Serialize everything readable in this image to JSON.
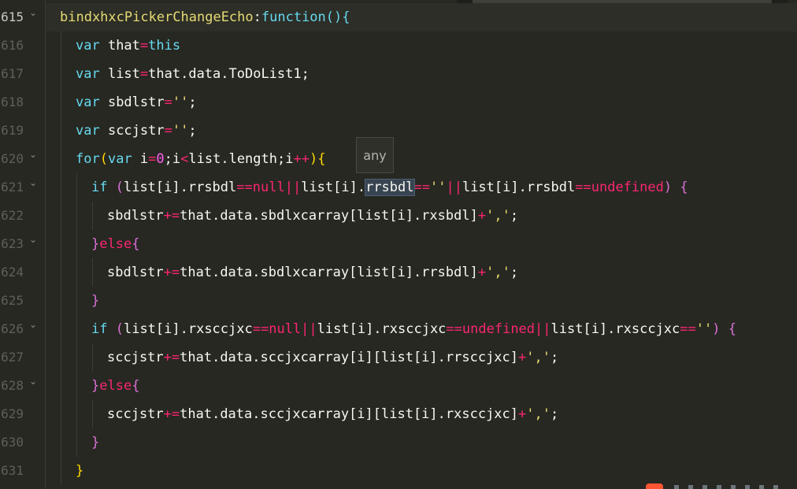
{
  "editor": {
    "line_numbers": [
      "615",
      "616",
      "617",
      "618",
      "619",
      "620",
      "621",
      "622",
      "623",
      "624",
      "625",
      "626",
      "627",
      "628",
      "629",
      "630",
      "631"
    ],
    "tooltip": "any",
    "lines": [
      [
        [
          "fn",
          "bindxhxcPickerChangeEcho"
        ],
        [
          "pl",
          ":"
        ],
        [
          "kw",
          "function"
        ],
        [
          "b1",
          "()"
        ],
        [
          "b1",
          "{"
        ]
      ],
      [
        [
          "kw",
          "var "
        ],
        [
          "pl",
          "that"
        ],
        [
          "op",
          "="
        ],
        [
          "kw",
          "this"
        ]
      ],
      [
        [
          "kw",
          "var "
        ],
        [
          "pl",
          "list"
        ],
        [
          "op",
          "="
        ],
        [
          "pl",
          "that.data.ToDoList1;"
        ]
      ],
      [
        [
          "kw",
          "var "
        ],
        [
          "pl",
          "sbdlstr"
        ],
        [
          "op",
          "="
        ],
        [
          "str",
          "''"
        ],
        [
          "pl",
          ";"
        ]
      ],
      [
        [
          "kw",
          "var "
        ],
        [
          "pl",
          "sccjstr"
        ],
        [
          "op",
          "="
        ],
        [
          "str",
          "''"
        ],
        [
          "pl",
          ";"
        ]
      ],
      [
        [
          "kw",
          "for"
        ],
        [
          "b2",
          "("
        ],
        [
          "kw",
          "var "
        ],
        [
          "pl",
          "i"
        ],
        [
          "op",
          "="
        ],
        [
          "num",
          "0"
        ],
        [
          "pl",
          ";i"
        ],
        [
          "op",
          "<"
        ],
        [
          "pl",
          "list.length;i"
        ],
        [
          "op",
          "++"
        ],
        [
          "b2",
          ")"
        ],
        [
          "b2",
          "{"
        ]
      ],
      [
        [
          "kw",
          "if "
        ],
        [
          "b3",
          "("
        ],
        [
          "pl",
          "list[i].rrsbdl"
        ],
        [
          "op",
          "=="
        ],
        [
          "nul",
          "null"
        ],
        [
          "op",
          "||"
        ],
        [
          "pl",
          "list[i]."
        ],
        [
          "hl",
          "rrsbdl"
        ],
        [
          "op",
          "=="
        ],
        [
          "str",
          "''"
        ],
        [
          "op",
          "||"
        ],
        [
          "pl",
          "list[i].rrsbdl"
        ],
        [
          "op",
          "=="
        ],
        [
          "nul",
          "undefined"
        ],
        [
          "b3",
          ")"
        ],
        [
          "pl",
          " "
        ],
        [
          "b3",
          "{"
        ]
      ],
      [
        [
          "pl",
          "sbdlstr"
        ],
        [
          "op",
          "+="
        ],
        [
          "pl",
          "that.data.sbdlxcarray[list[i].rxsbdl]"
        ],
        [
          "op",
          "+"
        ],
        [
          "str",
          "','"
        ],
        [
          "pl",
          ";"
        ]
      ],
      [
        [
          "b3",
          "}"
        ],
        [
          "kw2",
          "else"
        ],
        [
          "b3",
          "{"
        ]
      ],
      [
        [
          "pl",
          "sbdlstr"
        ],
        [
          "op",
          "+="
        ],
        [
          "pl",
          "that.data.sbdlxcarray[list[i].rrsbdl]"
        ],
        [
          "op",
          "+"
        ],
        [
          "str",
          "','"
        ],
        [
          "pl",
          ";"
        ]
      ],
      [
        [
          "b3",
          "}"
        ]
      ],
      [
        [
          "kw",
          "if "
        ],
        [
          "b3",
          "("
        ],
        [
          "pl",
          "list[i].rxsccjxc"
        ],
        [
          "op",
          "=="
        ],
        [
          "nul",
          "null"
        ],
        [
          "op",
          "||"
        ],
        [
          "pl",
          "list[i].rxsccjxc"
        ],
        [
          "op",
          "=="
        ],
        [
          "nul",
          "undefined"
        ],
        [
          "op",
          "||"
        ],
        [
          "pl",
          "list[i].rxsccjxc"
        ],
        [
          "op",
          "=="
        ],
        [
          "str",
          "''"
        ],
        [
          "b3",
          ")"
        ],
        [
          "pl",
          " "
        ],
        [
          "b3",
          "{"
        ]
      ],
      [
        [
          "pl",
          "sccjstr"
        ],
        [
          "op",
          "+="
        ],
        [
          "pl",
          "that.data.sccjxcarray[i][list[i].rrsccjxc]"
        ],
        [
          "op",
          "+"
        ],
        [
          "str",
          "','"
        ],
        [
          "pl",
          ";"
        ]
      ],
      [
        [
          "b3",
          "}"
        ],
        [
          "kw2",
          "else"
        ],
        [
          "b3",
          "{"
        ]
      ],
      [
        [
          "pl",
          "sccjstr"
        ],
        [
          "op",
          "+="
        ],
        [
          "pl",
          "that.data.sccjxcarray[i][list[i].rxsccjxc]"
        ],
        [
          "op",
          "+"
        ],
        [
          "str",
          "','"
        ],
        [
          "pl",
          ";"
        ]
      ],
      [
        [
          "b3",
          "}"
        ]
      ],
      [
        [
          "b2",
          "}"
        ]
      ]
    ]
  }
}
